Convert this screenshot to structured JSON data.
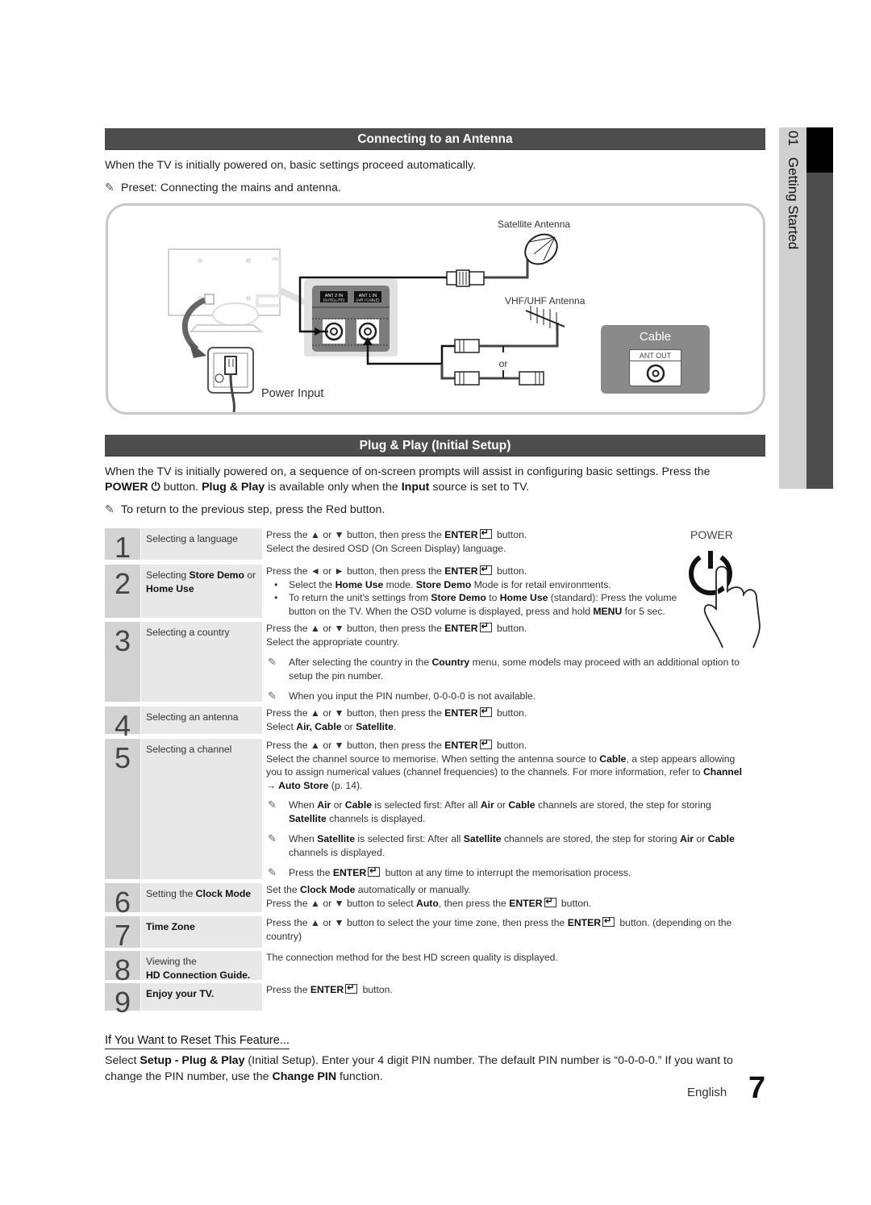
{
  "side_tab": {
    "number": "01",
    "label": "Getting Started"
  },
  "antenna_section": {
    "title": "Connecting to an Antenna",
    "intro": "When the TV is initially powered on, basic settings proceed automatically.",
    "note": "Preset: Connecting the mains and antenna.",
    "diagram": {
      "satellite_label": "Satellite Antenna",
      "vhf_label": "VHF/UHF Antenna",
      "or_label": "or",
      "power_input_label": "Power Input",
      "ant2_label": "ANT 2 IN",
      "ant2_sub": "(SATELLITE)",
      "ant1_label": "ANT 1 IN",
      "ant1_sub": "(AIR / CABLE)",
      "cable_title": "Cable",
      "ant_out_label": "ANT OUT"
    }
  },
  "plug_play_section": {
    "title": "Plug & Play (Initial Setup)",
    "intro_1": "When the TV is initially powered on, a sequence of on-screen prompts will assist in configuring basic settings. Press the",
    "intro_power": "POWER",
    "intro_2": "button.",
    "intro_pp": "Plug & Play",
    "intro_3": "is available only when the",
    "intro_input": "Input",
    "intro_4": "source is set to TV.",
    "note": "To return to the previous step, press the Red button.",
    "power_illustration_label": "POWER"
  },
  "steps": [
    {
      "num": "1",
      "title": "Selecting a language"
    },
    {
      "num": "2",
      "title_pre": "Selecting",
      "title_b1": "Store Demo",
      "title_mid": "or",
      "title_b2": "Home Use"
    },
    {
      "num": "3",
      "title": "Selecting a country"
    },
    {
      "num": "4",
      "title": "Selecting an antenna"
    },
    {
      "num": "5",
      "title": "Selecting a channel"
    },
    {
      "num": "6",
      "title_pre": "Setting the",
      "title_b1": "Clock Mode"
    },
    {
      "num": "7",
      "title_b1": "Time Zone"
    },
    {
      "num": "8",
      "title_pre": "Viewing the",
      "title_b1": "HD Connection Guide."
    },
    {
      "num": "9",
      "title_b1": "Enjoy your TV."
    }
  ],
  "desc": {
    "s1_l1a": "Press the ▲ or ▼ button, then press the",
    "enter": "ENTER",
    "button": "button.",
    "s1_l2": "Select the desired OSD (On Screen Display) language.",
    "s2_l1a": "Press the ◄ or ► button, then press the",
    "s2_b1a": "Select the",
    "home_use": "Home Use",
    "s2_b1b": "mode.",
    "store_demo": "Store Demo",
    "s2_b1c": "Mode is for retail environments.",
    "s2_b2a": "To return the unit's settings from",
    "s2_b2b": "to",
    "s2_b2c": "(standard): Press the volume button on the TV. When the OSD volume is displayed, press and hold",
    "menu": "MENU",
    "s2_b2d": "for 5 sec.",
    "s3_l2": "Select the appropriate country.",
    "s3_n1a": "After selecting the country in the",
    "country": "Country",
    "s3_n1b": "menu, some models may proceed with an additional option to setup the pin number.",
    "s3_n2": "When you input the PIN number, 0-0-0-0 is not available.",
    "s4_l2a": "Select",
    "air_c": "Air, Cable",
    "or": "or",
    "satellite": "Satellite",
    "period": ".",
    "s5_l2a": "Select the channel source to memorise. When setting the antenna source to",
    "cable": "Cable",
    "s5_l2b": ", a step appears allowing you to assign numerical values (channel frequencies) to the channels. For more information, refer to",
    "channel_auto": "Channel → Auto Store",
    "s5_l2c": "(p. 14).",
    "when": "When",
    "air": "Air",
    "s5_n1b": "is selected first: After all",
    "s5_n1c": "channels are stored, the step for storing",
    "s5_n1d": "channels is displayed.",
    "s5_n3a": "Press the",
    "s5_n3b": "button at any time to interrupt the memorisation process.",
    "s6_l1a": "Set the",
    "clock_mode": "Clock Mode",
    "s6_l1b": "automatically or manually.",
    "s6_l2a": "Press the ▲ or ▼ button to select",
    "auto": "Auto",
    "s6_l2b": ", then press the",
    "s7_a": "Press the ▲ or ▼ button to select the your time zone, then press the",
    "s7_b": "button. (depending on the country)",
    "s8": "The connection method for the best HD screen quality is displayed.",
    "s9a": "Press the"
  },
  "reset": {
    "title": "If You Want to Reset This Feature...",
    "t1": "Select",
    "b1": "Setup - Plug & Play",
    "t2": "(Initial Setup). Enter your 4 digit PIN number. The default PIN number is “0-0-0-0.” If you want to change the PIN number, use the",
    "b2": "Change PIN",
    "t3": "function."
  },
  "footer": {
    "language": "English",
    "page_number": "7"
  }
}
